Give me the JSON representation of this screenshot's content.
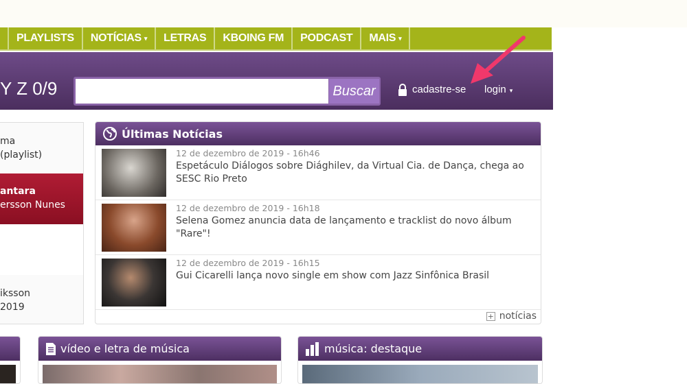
{
  "nav": {
    "items": [
      {
        "label": ""
      },
      {
        "label": "PLAYLISTS"
      },
      {
        "label": "NOTÍCIAS",
        "caret": "▾"
      },
      {
        "label": "LETRAS"
      },
      {
        "label": "KBOING FM"
      },
      {
        "label": "PODCAST"
      },
      {
        "label": "MAIS",
        "caret": "▾"
      }
    ]
  },
  "header": {
    "az": "Y Z 0/9",
    "search_placeholder": "",
    "search_button": "Buscar",
    "signup": "cadastre-se",
    "login": "login",
    "login_caret": "▾"
  },
  "left": {
    "items": [
      {
        "line1": "ma",
        "line2": "(playlist)"
      },
      {
        "line1": "antara",
        "line2": "ersson Nunes"
      },
      {
        "line1": "iksson",
        "line2": "2019"
      }
    ]
  },
  "news": {
    "title": "Últimas Notícias",
    "items": [
      {
        "date": "12 de dezembro de 2019 - 16h46",
        "title": "Espetáculo Diálogos sobre Diághilev, da Virtual Cia. de Dança, chega ao SESC Rio Preto"
      },
      {
        "date": "12 de dezembro de 2019 - 16h18",
        "title": "Selena Gomez anuncia data de lançamento e tracklist do novo álbum \"Rare\"!"
      },
      {
        "date": "12 de dezembro de 2019 - 16h15",
        "title": "Gui Cicarelli lança novo single em show com Jazz Sinfônica Brasil"
      }
    ],
    "more": "notícias"
  },
  "panels": {
    "video": "vídeo e letra de música",
    "destaque": "música: destaque"
  },
  "colors": {
    "nav": "#a4b41a",
    "header": "#5c3b72",
    "active": "#a01830",
    "arrow": "#f0386b"
  }
}
